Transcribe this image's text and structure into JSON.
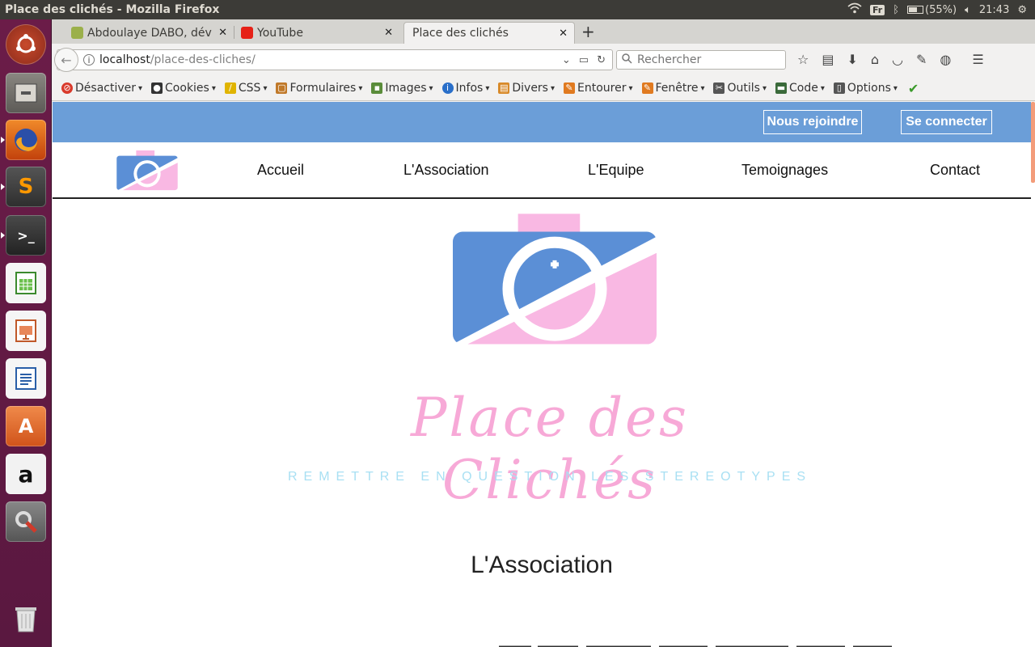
{
  "system": {
    "window_title": "Place des clichés - Mozilla Firefox",
    "keyboard_layout": "Fr",
    "battery": "(55%)",
    "clock": "21:43"
  },
  "launcher": {
    "items": [
      {
        "name": "ubuntu-dash-icon"
      },
      {
        "name": "files-icon"
      },
      {
        "name": "firefox-icon"
      },
      {
        "name": "sublime-text-icon"
      },
      {
        "name": "terminal-icon"
      },
      {
        "name": "libreoffice-calc-icon"
      },
      {
        "name": "libreoffice-impress-icon"
      },
      {
        "name": "libreoffice-writer-icon"
      },
      {
        "name": "software-center-icon"
      },
      {
        "name": "amazon-icon"
      },
      {
        "name": "system-settings-icon"
      },
      {
        "name": "trash-icon"
      }
    ]
  },
  "browser": {
    "tabs": [
      {
        "label": "Abdoulaye DABO, dév",
        "active": false
      },
      {
        "label": "YouTube",
        "active": false
      },
      {
        "label": "Place des clichés",
        "active": true
      }
    ],
    "url_host": "localhost",
    "url_path": "/place-des-cliches/",
    "search_placeholder": "Rechercher",
    "webdev_toolbar": [
      {
        "label": "Désactiver",
        "icon": "disable-icon",
        "color": "#d93a2b"
      },
      {
        "label": "Cookies",
        "icon": "cookie-icon",
        "color": "#333333"
      },
      {
        "label": "CSS",
        "icon": "css-wand-icon",
        "color": "#e0b400"
      },
      {
        "label": "Formulaires",
        "icon": "form-icon",
        "color": "#c0792a"
      },
      {
        "label": "Images",
        "icon": "image-icon",
        "color": "#5a8c3a"
      },
      {
        "label": "Infos",
        "icon": "info-icon",
        "color": "#2a6fc9"
      },
      {
        "label": "Divers",
        "icon": "misc-icon",
        "color": "#d88a2a"
      },
      {
        "label": "Entourer",
        "icon": "outline-pencil-icon",
        "color": "#e07a20"
      },
      {
        "label": "Fenêtre",
        "icon": "window-pencil-icon",
        "color": "#e07a20"
      },
      {
        "label": "Outils",
        "icon": "tools-icon",
        "color": "#555555"
      },
      {
        "label": "Code",
        "icon": "code-icon",
        "color": "#3a6a3a"
      },
      {
        "label": "Options",
        "icon": "options-icon",
        "color": "#555555"
      }
    ]
  },
  "site": {
    "top_buttons": {
      "join": "Nous rejoindre",
      "login": "Se connecter"
    },
    "nav": [
      "Accueil",
      "L'Association",
      "L'Equipe",
      "Temoignages",
      "Contact"
    ],
    "title": "Place des Clichés",
    "tagline": "REMETTRE EN QUESTION LES STEREOTYPES",
    "section_heading": "L'Association",
    "colors": {
      "topbar": "#6b9ed8",
      "logo_blue": "#5b8fd6",
      "logo_pink": "#f9b8e3",
      "title_pink": "#f7a9d7",
      "tagline_blue": "#a9e0f3"
    }
  }
}
